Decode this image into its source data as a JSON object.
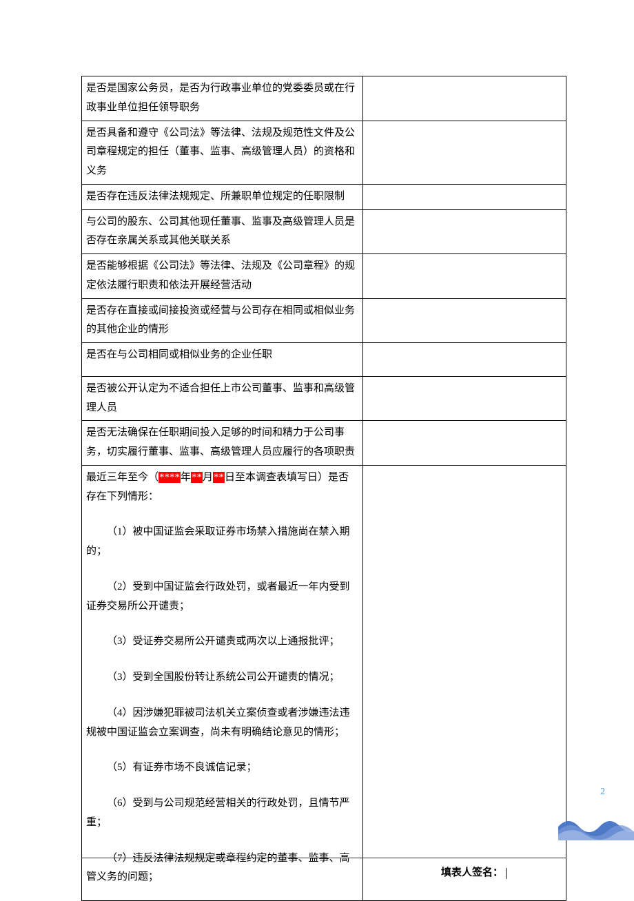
{
  "rows": {
    "r1": "是否是国家公务员，是否为行政事业单位的党委委员或在行政事业单位担任领导职务",
    "r2": "是否具备和遵守《公司法》等法律、法规及规范性文件及公司章程规定的担任（董事、监事、高级管理人员）的资格和义务",
    "r3": "是否存在违反法律法规规定、所兼职单位规定的任职限制",
    "r4": "与公司的股东、公司其他现任董事、监事及高级管理人员是否存在亲属关系或其他关联关系",
    "r5": "是否能够根据《公司法》等法律、法规及《公司章程》的规定依法履行职责和依法开展经营活动",
    "r6": "是否存在直接或间接投资或经营与公司存在相同或相似业务的其他企业的情形",
    "r7": "是否在与公司相同或相似业务的企业任职",
    "r8": "是否被公开认定为不适合担任上市公司董事、监事和高级管理人员",
    "r9": "是否无法确保在任职期间投入足够的时间和精力于公司事务，切实履行董事、监事、高级管理人员应履行的各项职责",
    "r10": {
      "lead_a": "最近三年至今（",
      "hl1": "****",
      "mid1": "年",
      "hl2": "**",
      "mid2": "月",
      "hl3": "**",
      "lead_b": "日至本调查表填写日）是否存在下列情形：",
      "items": [
        "（1）被中国证监会采取证券市场禁入措施尚在禁入期的；",
        "（2）受到中国证监会行政处罚，或者最近一年内受到证券交易所公开谴责；",
        "（3）受证券交易所公开谴责或两次以上通报批评；",
        "（3）受到全国股份转让系统公司公开谴责的情况；",
        "（4）因涉嫌犯罪被司法机关立案侦查或者涉嫌违法违规被中国证监会立案调查，尚未有明确结论意见的情形；",
        "（5）有证券市场不良诚信记录；",
        "（6）受到与公司规范经营相关的行政处罚，且情节严重；",
        "（7）违反法律法规规定或章程约定的董事、监事、高管义务的问题；"
      ]
    }
  },
  "pageNumber": "2",
  "footer": {
    "label": "填表人签名："
  }
}
